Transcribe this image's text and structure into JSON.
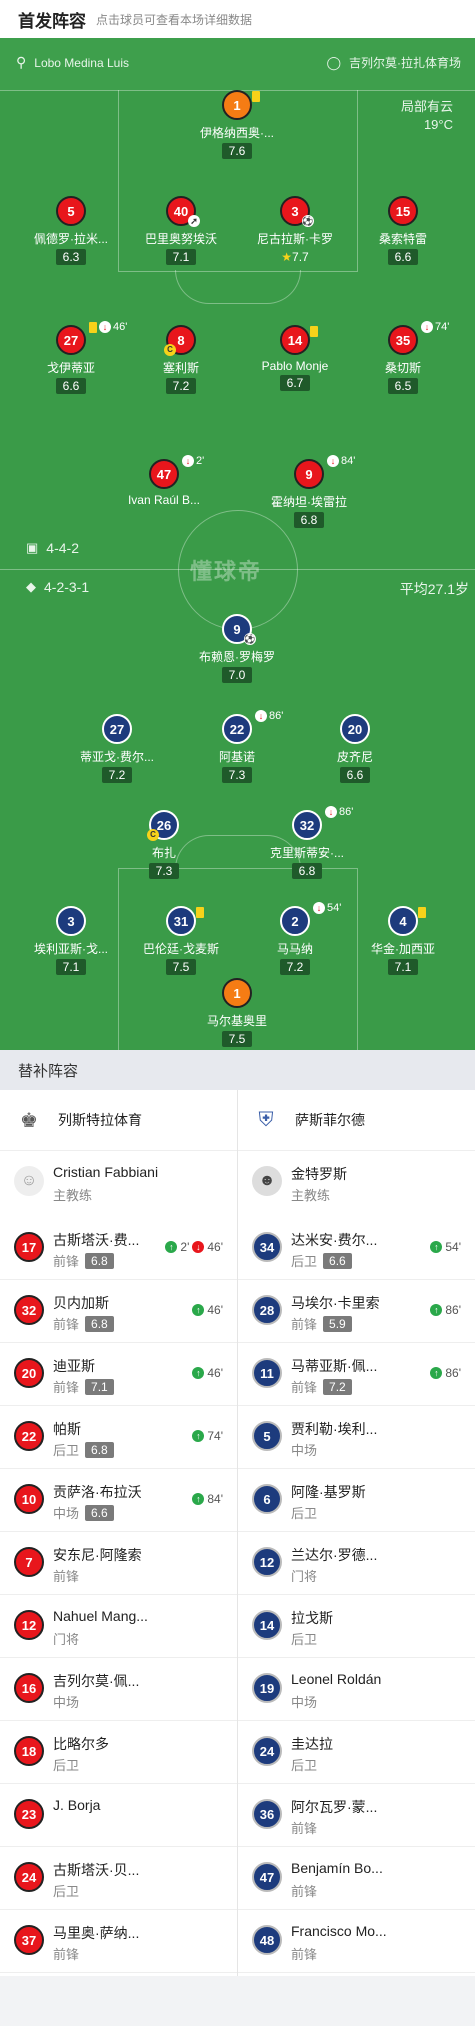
{
  "header": {
    "title": "首发阵容",
    "hint": "点击球员可查看本场详细数据"
  },
  "match": {
    "referee": "Lobo Medina Luis",
    "venue": "吉列尔莫·拉扎体育场",
    "weather": "局部有云",
    "temperature": "19°C"
  },
  "home": {
    "formation": "4-4-2",
    "players": [
      {
        "no": "1",
        "name": "伊格纳西奥·...",
        "rating": "7.6",
        "color": "orange"
      },
      {
        "no": "5",
        "name": "佩德罗·拉米...",
        "rating": "6.3",
        "color": "red"
      },
      {
        "no": "40",
        "name": "巴里奥努埃沃",
        "rating": "7.1",
        "color": "red"
      },
      {
        "no": "3",
        "name": "尼古拉斯·卡罗",
        "rating": "7.7",
        "color": "red"
      },
      {
        "no": "15",
        "name": "桑索特雷",
        "rating": "6.6",
        "color": "red"
      },
      {
        "no": "27",
        "name": "戈伊蒂亚",
        "rating": "6.6",
        "color": "red",
        "event": "46'"
      },
      {
        "no": "8",
        "name": "塞利斯",
        "rating": "7.2",
        "color": "red"
      },
      {
        "no": "14",
        "name": "Pablo Monje",
        "rating": "6.7",
        "color": "red"
      },
      {
        "no": "35",
        "name": "桑切斯",
        "rating": "6.5",
        "color": "red",
        "event": "74'"
      },
      {
        "no": "47",
        "name": "Ivan Raúl B...",
        "rating": "",
        "color": "red",
        "event": "2'"
      },
      {
        "no": "9",
        "name": "霍纳坦·埃雷拉",
        "rating": "6.8",
        "color": "red",
        "event": "84'"
      }
    ]
  },
  "away": {
    "formation": "4-2-3-1",
    "avg_age": "平均27.1岁",
    "players": [
      {
        "no": "9",
        "name": "布赖恩·罗梅罗",
        "rating": "7.0"
      },
      {
        "no": "27",
        "name": "蒂亚戈·费尔...",
        "rating": "7.2"
      },
      {
        "no": "22",
        "name": "阿基诺",
        "rating": "7.3",
        "event": "86'"
      },
      {
        "no": "20",
        "name": "皮齐尼",
        "rating": "6.6"
      },
      {
        "no": "26",
        "name": "布扎",
        "rating": "7.3"
      },
      {
        "no": "32",
        "name": "克里斯蒂安·...",
        "rating": "6.8",
        "event": "86'"
      },
      {
        "no": "3",
        "name": "埃利亚斯·戈...",
        "rating": "7.1"
      },
      {
        "no": "31",
        "name": "巴伦廷·戈麦斯",
        "rating": "7.5"
      },
      {
        "no": "2",
        "name": "马马纳",
        "rating": "7.2",
        "event": "54'"
      },
      {
        "no": "4",
        "name": "华金·加西亚",
        "rating": "7.1"
      },
      {
        "no": "1",
        "name": "马尔基奥里",
        "rating": "7.5"
      }
    ]
  },
  "watermark": "懂球帝",
  "subs": {
    "title": "替补阵容",
    "home_team": "列斯特拉体育",
    "away_team": "萨斯菲尔德",
    "home_coach": {
      "name": "Cristian Fabbiani",
      "role": "主教练"
    },
    "away_coach": {
      "name": "金特罗斯",
      "role": "主教练"
    },
    "home": [
      {
        "no": "17",
        "name": "古斯塔沃·费...",
        "pos": "前锋",
        "rating": "6.8",
        "ev_in": "2'",
        "ev_out": "46'"
      },
      {
        "no": "32",
        "name": "贝内加斯",
        "pos": "前锋",
        "rating": "6.8",
        "ev_in": "46'"
      },
      {
        "no": "20",
        "name": "迪亚斯",
        "pos": "前锋",
        "rating": "7.1",
        "ev_in": "46'"
      },
      {
        "no": "22",
        "name": "帕斯",
        "pos": "后卫",
        "rating": "6.8",
        "ev_in": "74'"
      },
      {
        "no": "10",
        "name": "贡萨洛·布拉沃",
        "pos": "中场",
        "rating": "6.6",
        "ev_in": "84'"
      },
      {
        "no": "7",
        "name": "安东尼·阿隆索",
        "pos": "前锋"
      },
      {
        "no": "12",
        "name": "Nahuel Mang...",
        "pos": "门将"
      },
      {
        "no": "16",
        "name": "吉列尔莫·佩...",
        "pos": "中场"
      },
      {
        "no": "18",
        "name": "比略尔多",
        "pos": "后卫"
      },
      {
        "no": "23",
        "name": "J. Borja",
        "pos": ""
      },
      {
        "no": "24",
        "name": "古斯塔沃·贝...",
        "pos": "后卫"
      },
      {
        "no": "37",
        "name": "马里奥·萨纳...",
        "pos": "前锋"
      }
    ],
    "away": [
      {
        "no": "34",
        "name": "达米安·费尔...",
        "pos": "后卫",
        "rating": "6.6",
        "ev_in": "54'"
      },
      {
        "no": "28",
        "name": "马埃尔·卡里索",
        "pos": "前锋",
        "rating": "5.9",
        "ev_in": "86'"
      },
      {
        "no": "11",
        "name": "马蒂亚斯·佩...",
        "pos": "前锋",
        "rating": "7.2",
        "ev_in": "86'"
      },
      {
        "no": "5",
        "name": "贾利勒·埃利...",
        "pos": "中场"
      },
      {
        "no": "6",
        "name": "阿隆·基罗斯",
        "pos": "后卫"
      },
      {
        "no": "12",
        "name": "兰达尔·罗德...",
        "pos": "门将"
      },
      {
        "no": "14",
        "name": "拉戈斯",
        "pos": "后卫"
      },
      {
        "no": "19",
        "name": "Leonel Roldán",
        "pos": "中场"
      },
      {
        "no": "24",
        "name": "圭达拉",
        "pos": "后卫"
      },
      {
        "no": "36",
        "name": "阿尔瓦罗·蒙...",
        "pos": "前锋"
      },
      {
        "no": "47",
        "name": "Benjamín Bo...",
        "pos": "前锋"
      },
      {
        "no": "48",
        "name": "Francisco Mo...",
        "pos": "前锋"
      }
    ]
  }
}
